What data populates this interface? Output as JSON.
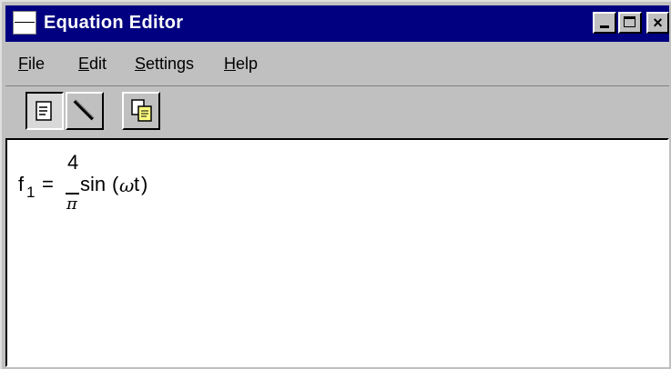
{
  "window": {
    "title": "Equation Editor",
    "controls": {
      "minimize": "_",
      "maximize": "□",
      "close": "×"
    }
  },
  "menu": {
    "items": [
      {
        "label": "File",
        "accel": "F",
        "rest": "ile"
      },
      {
        "label": "Edit",
        "accel": "E",
        "rest": "dit"
      },
      {
        "label": "Settings",
        "accel": "S",
        "rest": "ettings"
      },
      {
        "label": "Help",
        "accel": "H",
        "rest": "elp"
      }
    ]
  },
  "toolbar": {
    "buttons": [
      {
        "name": "document-icon",
        "pressed": true
      },
      {
        "name": "pen-icon",
        "pressed": false
      },
      {
        "name": "copy-icon",
        "pressed": false
      }
    ]
  },
  "editor": {
    "equation": {
      "lhs_base": "f",
      "lhs_sub": "1",
      "equals": "=",
      "numerator": "4",
      "denominator": "π",
      "function": "sin",
      "open_paren": "(",
      "argument_omega": "ω",
      "argument_t": "t",
      "close_paren": ")"
    }
  },
  "colors": {
    "titlebar_bg": "#000080",
    "window_bg": "#c0c0c0",
    "editor_bg": "#ffffff"
  }
}
